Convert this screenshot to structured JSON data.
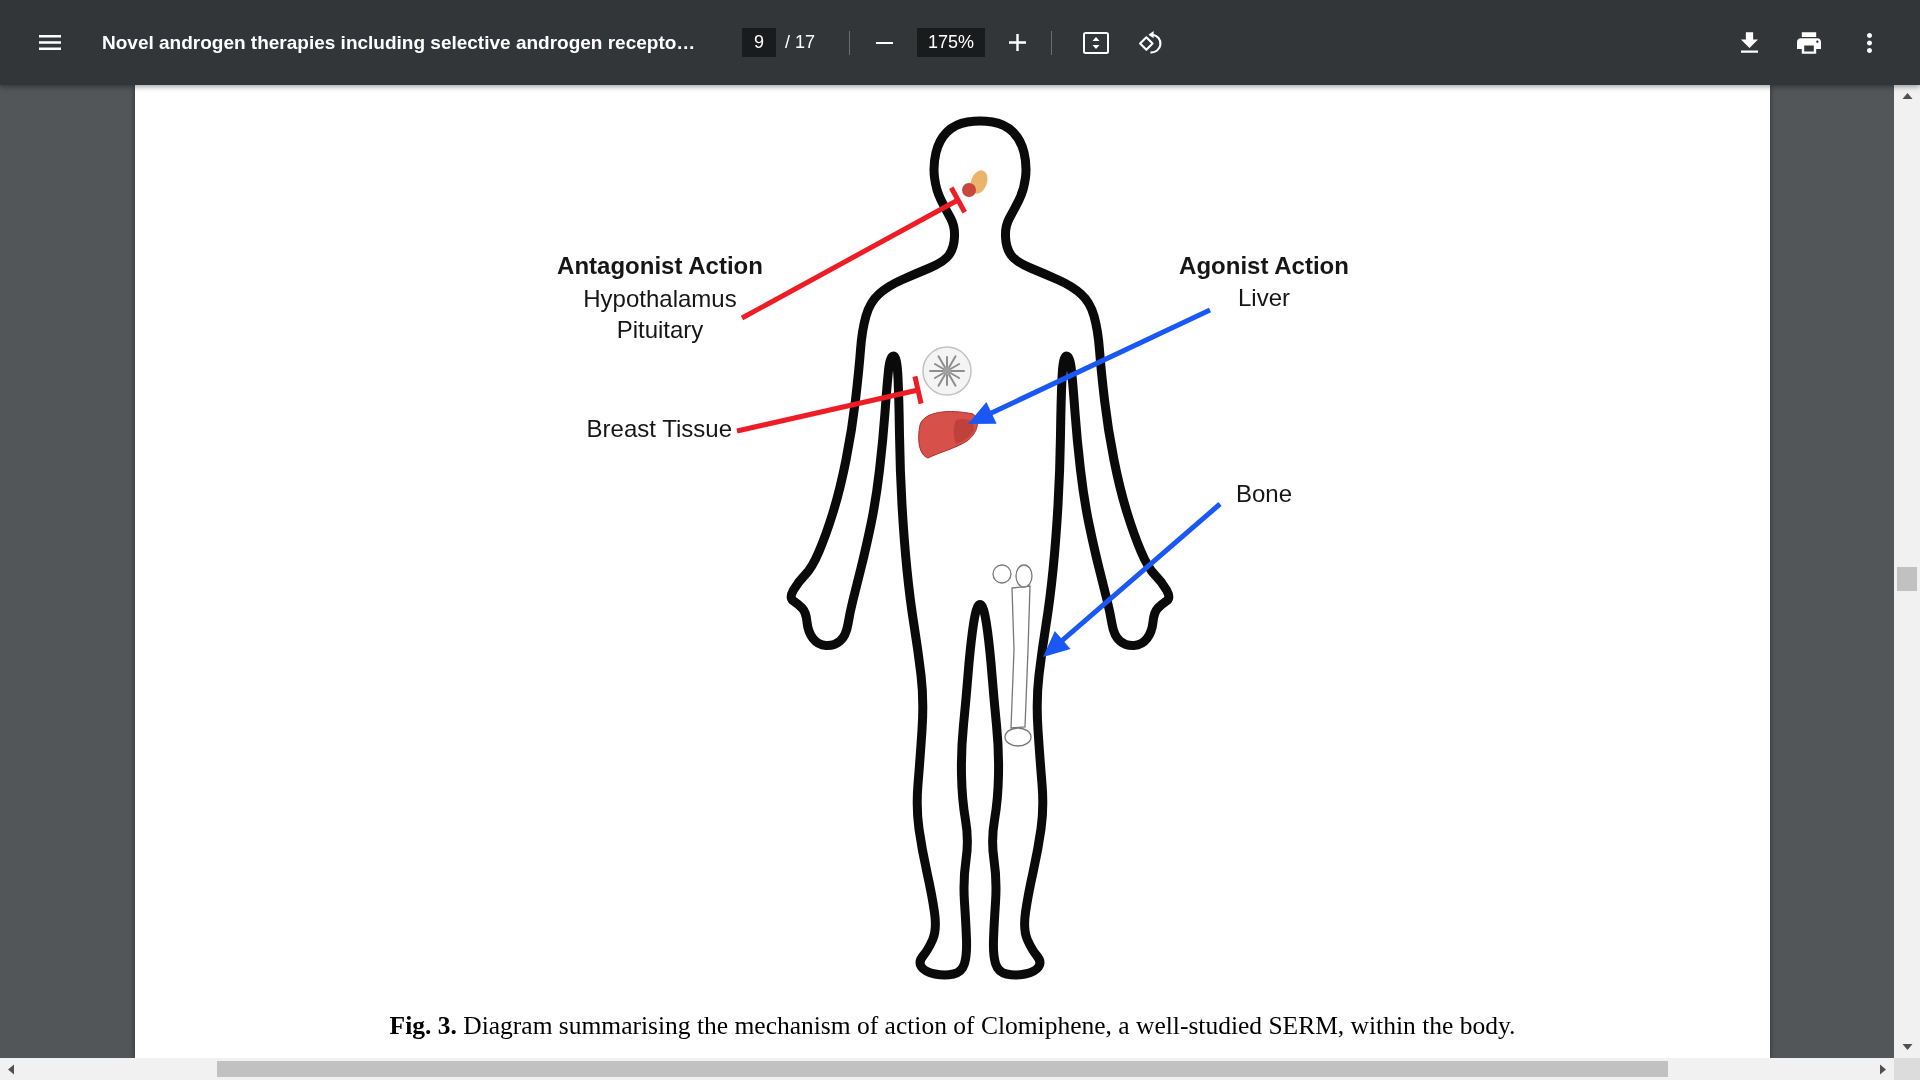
{
  "toolbar": {
    "title": "Novel androgen therapies including selective androgen recepto…",
    "page": "9",
    "page_count": "/ 17",
    "zoom": "175%"
  },
  "figure": {
    "groups": [
      {
        "kind": "antagonist",
        "heading": "Antagonist Action",
        "targets": [
          {
            "labels": [
              "Hypothalamus",
              "Pituitary"
            ]
          },
          {
            "labels": [
              "Breast Tissue"
            ]
          }
        ]
      },
      {
        "kind": "agonist",
        "heading": "Agonist Action",
        "targets": [
          {
            "labels": [
              "Liver"
            ]
          },
          {
            "labels": [
              "Bone"
            ]
          }
        ]
      }
    ],
    "caption": "**Fig. 3.** Diagram summarising the mechanism of action of Clomiphene, a well-studied SERM, within the body."
  }
}
